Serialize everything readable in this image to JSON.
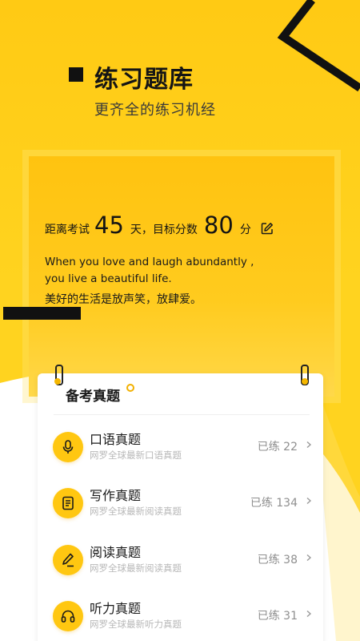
{
  "header": {
    "title": "练习题库",
    "subtitle": "更齐全的练习机经"
  },
  "panel": {
    "days_prefix": "距离考试",
    "days_value": "45",
    "days_suffix": "天，目标分数",
    "score_value": "80",
    "score_suffix": "分",
    "edit_icon": "edit-icon",
    "quote_en_line1": "When  you  love and laugh abundantly ,",
    "quote_en_line2": "you live a beautiful life.",
    "quote_cn": "美好的生活是放声笑，放肆爱。"
  },
  "card": {
    "title": "备考真题",
    "items": [
      {
        "title": "口语真题",
        "subtitle": "网罗全球最新口语真题",
        "count": "已练 22",
        "icon": "microphone-icon"
      },
      {
        "title": "写作真题",
        "subtitle": "网罗全球最新阅读真题",
        "count": "已练 134",
        "icon": "document-icon"
      },
      {
        "title": "阅读真题",
        "subtitle": "网罗全球最新阅读真题",
        "count": "已练 38",
        "icon": "pen-icon"
      },
      {
        "title": "听力真题",
        "subtitle": "网罗全球最新听力真题",
        "count": "已练 31",
        "icon": "headphones-icon"
      }
    ]
  },
  "colors": {
    "accent": "#FFC711",
    "background": "#FFD31F",
    "text": "#1A1A1A"
  }
}
